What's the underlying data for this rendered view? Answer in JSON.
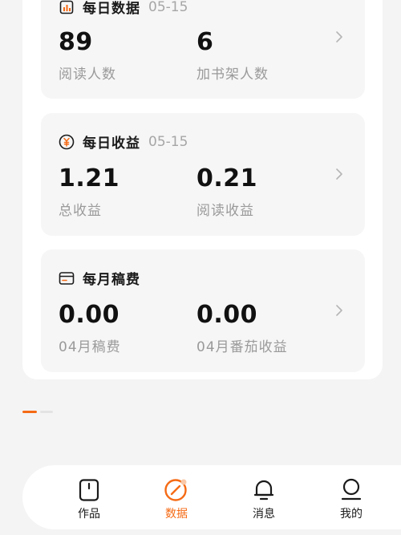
{
  "colors": {
    "accent": "#f56a14",
    "text": "#1a1a1a",
    "muted": "#9a9a9a",
    "date": "#a6a6a6"
  },
  "cards": [
    {
      "title": "每日数据",
      "date": "05-15",
      "icon": "bar-chart-icon",
      "metrics": [
        {
          "value": "89",
          "label": "阅读人数"
        },
        {
          "value": "6",
          "label": "加书架人数"
        }
      ]
    },
    {
      "title": "每日收益",
      "date": "05-15",
      "icon": "yuan-coin-icon",
      "metrics": [
        {
          "value": "1.21",
          "label": "总收益"
        },
        {
          "value": "0.21",
          "label": "阅读收益"
        }
      ]
    },
    {
      "title": "每月稿费",
      "date": "",
      "icon": "card-icon",
      "metrics": [
        {
          "value": "0.00",
          "label": "04月稿费"
        },
        {
          "value": "0.00",
          "label": "04月番茄收益"
        }
      ]
    }
  ],
  "pager": {
    "count": 2,
    "active": 0
  },
  "tabs": [
    {
      "label": "作品",
      "icon": "works-icon",
      "active": false
    },
    {
      "label": "数据",
      "icon": "data-icon",
      "active": true
    },
    {
      "label": "消息",
      "icon": "bell-icon",
      "active": false
    },
    {
      "label": "我的",
      "icon": "profile-icon",
      "active": false
    }
  ]
}
